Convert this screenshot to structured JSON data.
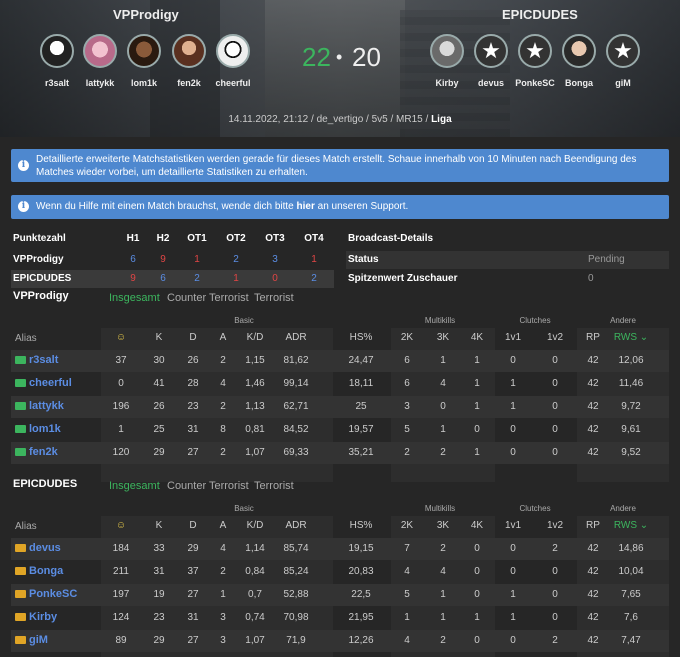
{
  "header": {
    "team_a": "VPProdigy",
    "team_b": "EPICDUDES",
    "score_a": "22",
    "score_sep": "•",
    "score_b": "20",
    "team_a_players": [
      "r3salt",
      "lattykk",
      "lom1k",
      "fen2k",
      "cheerful"
    ],
    "team_b_players": [
      "Kirby",
      "devus",
      "PonkeSC",
      "Bonga",
      "giM"
    ],
    "match_info": "14.11.2022, 21:12 / de_vertigo / 5v5 / MR15 /",
    "match_league": "Liga"
  },
  "alerts": {
    "stats_notice": "Detaillierte erweiterte Matchstatistiken werden gerade für dieses Match erstellt. Schaue innerhalb von 10 Minuten nach Beendigung des Matches wieder vorbei, um detaillierte Statistiken zu erhalten.",
    "help_pre": "Wenn du Hilfe mit einem Match brauchst, wende dich bitte",
    "help_link": "hier",
    "help_post": "an unseren Support."
  },
  "scoreboard": {
    "title": "Punktezahl",
    "columns": [
      "H1",
      "H2",
      "OT1",
      "OT2",
      "OT3",
      "OT4"
    ],
    "rows": [
      {
        "team": "VPProdigy",
        "values": [
          "6",
          "9",
          "1",
          "2",
          "3",
          "1"
        ],
        "colors": [
          "blue",
          "red",
          "red",
          "blue",
          "blue",
          "red"
        ]
      },
      {
        "team": "EPICDUDES",
        "values": [
          "9",
          "6",
          "2",
          "1",
          "0",
          "2"
        ],
        "colors": [
          "red",
          "blue",
          "blue",
          "red",
          "red",
          "blue"
        ]
      }
    ]
  },
  "broadcast": {
    "title": "Broadcast-Details",
    "status_label": "Status",
    "status_value": "Pending",
    "peak_label": "Spitzenwert Zuschauer",
    "peak_value": "0"
  },
  "tabs": {
    "overall": "Insgesamt",
    "ct": "Counter Terrorist",
    "t": "Terrorist"
  },
  "groups": {
    "basic": "Basic",
    "multikills": "Multikills",
    "clutches": "Clutches",
    "other": "Andere"
  },
  "columns": [
    "Alias",
    "☺",
    "K",
    "D",
    "A",
    "K/D",
    "ADR",
    "HS%",
    "2K",
    "3K",
    "4K",
    "1v1",
    "1v2",
    "RP",
    "RWS ⌄"
  ],
  "team_a_stats": {
    "name": "VPProdigy",
    "players": [
      {
        "name": "r3salt",
        "v": [
          "37",
          "30",
          "26",
          "2",
          "1,15",
          "81,62",
          "24,47",
          "6",
          "1",
          "1",
          "0",
          "0",
          "42",
          "12,06"
        ]
      },
      {
        "name": "cheerful",
        "v": [
          "0",
          "41",
          "28",
          "4",
          "1,46",
          "99,14",
          "18,11",
          "6",
          "4",
          "1",
          "1",
          "0",
          "42",
          "11,46"
        ]
      },
      {
        "name": "lattykk",
        "v": [
          "196",
          "26",
          "23",
          "2",
          "1,13",
          "62,71",
          "25",
          "3",
          "0",
          "1",
          "1",
          "0",
          "42",
          "9,72"
        ]
      },
      {
        "name": "lom1k",
        "v": [
          "1",
          "25",
          "31",
          "8",
          "0,81",
          "84,52",
          "19,57",
          "5",
          "1",
          "0",
          "0",
          "0",
          "42",
          "9,61"
        ]
      },
      {
        "name": "fen2k",
        "v": [
          "120",
          "29",
          "27",
          "2",
          "1,07",
          "69,33",
          "35,21",
          "2",
          "2",
          "1",
          "0",
          "0",
          "42",
          "9,52"
        ]
      }
    ]
  },
  "team_b_stats": {
    "name": "EPICDUDES",
    "players": [
      {
        "name": "devus",
        "v": [
          "184",
          "33",
          "29",
          "4",
          "1,14",
          "85,74",
          "19,15",
          "7",
          "2",
          "0",
          "0",
          "2",
          "42",
          "14,86"
        ]
      },
      {
        "name": "Bonga",
        "v": [
          "211",
          "31",
          "37",
          "2",
          "0,84",
          "85,24",
          "20,83",
          "4",
          "4",
          "0",
          "0",
          "0",
          "42",
          "10,04"
        ]
      },
      {
        "name": "PonkeSC",
        "v": [
          "197",
          "19",
          "27",
          "1",
          "0,7",
          "52,88",
          "22,5",
          "5",
          "1",
          "0",
          "1",
          "0",
          "42",
          "7,65"
        ]
      },
      {
        "name": "Kirby",
        "v": [
          "124",
          "23",
          "31",
          "3",
          "0,74",
          "70,98",
          "21,95",
          "1",
          "1",
          "1",
          "1",
          "0",
          "42",
          "7,6"
        ]
      },
      {
        "name": "giM",
        "v": [
          "89",
          "29",
          "27",
          "3",
          "1,07",
          "71,9",
          "12,26",
          "4",
          "2",
          "0",
          "0",
          "2",
          "42",
          "7,47"
        ]
      }
    ]
  },
  "colors": {
    "accent_green": "#3cb55e",
    "link_blue": "#5b8de3",
    "alert_blue": "#4e88cf",
    "loss_red": "#e04545"
  }
}
